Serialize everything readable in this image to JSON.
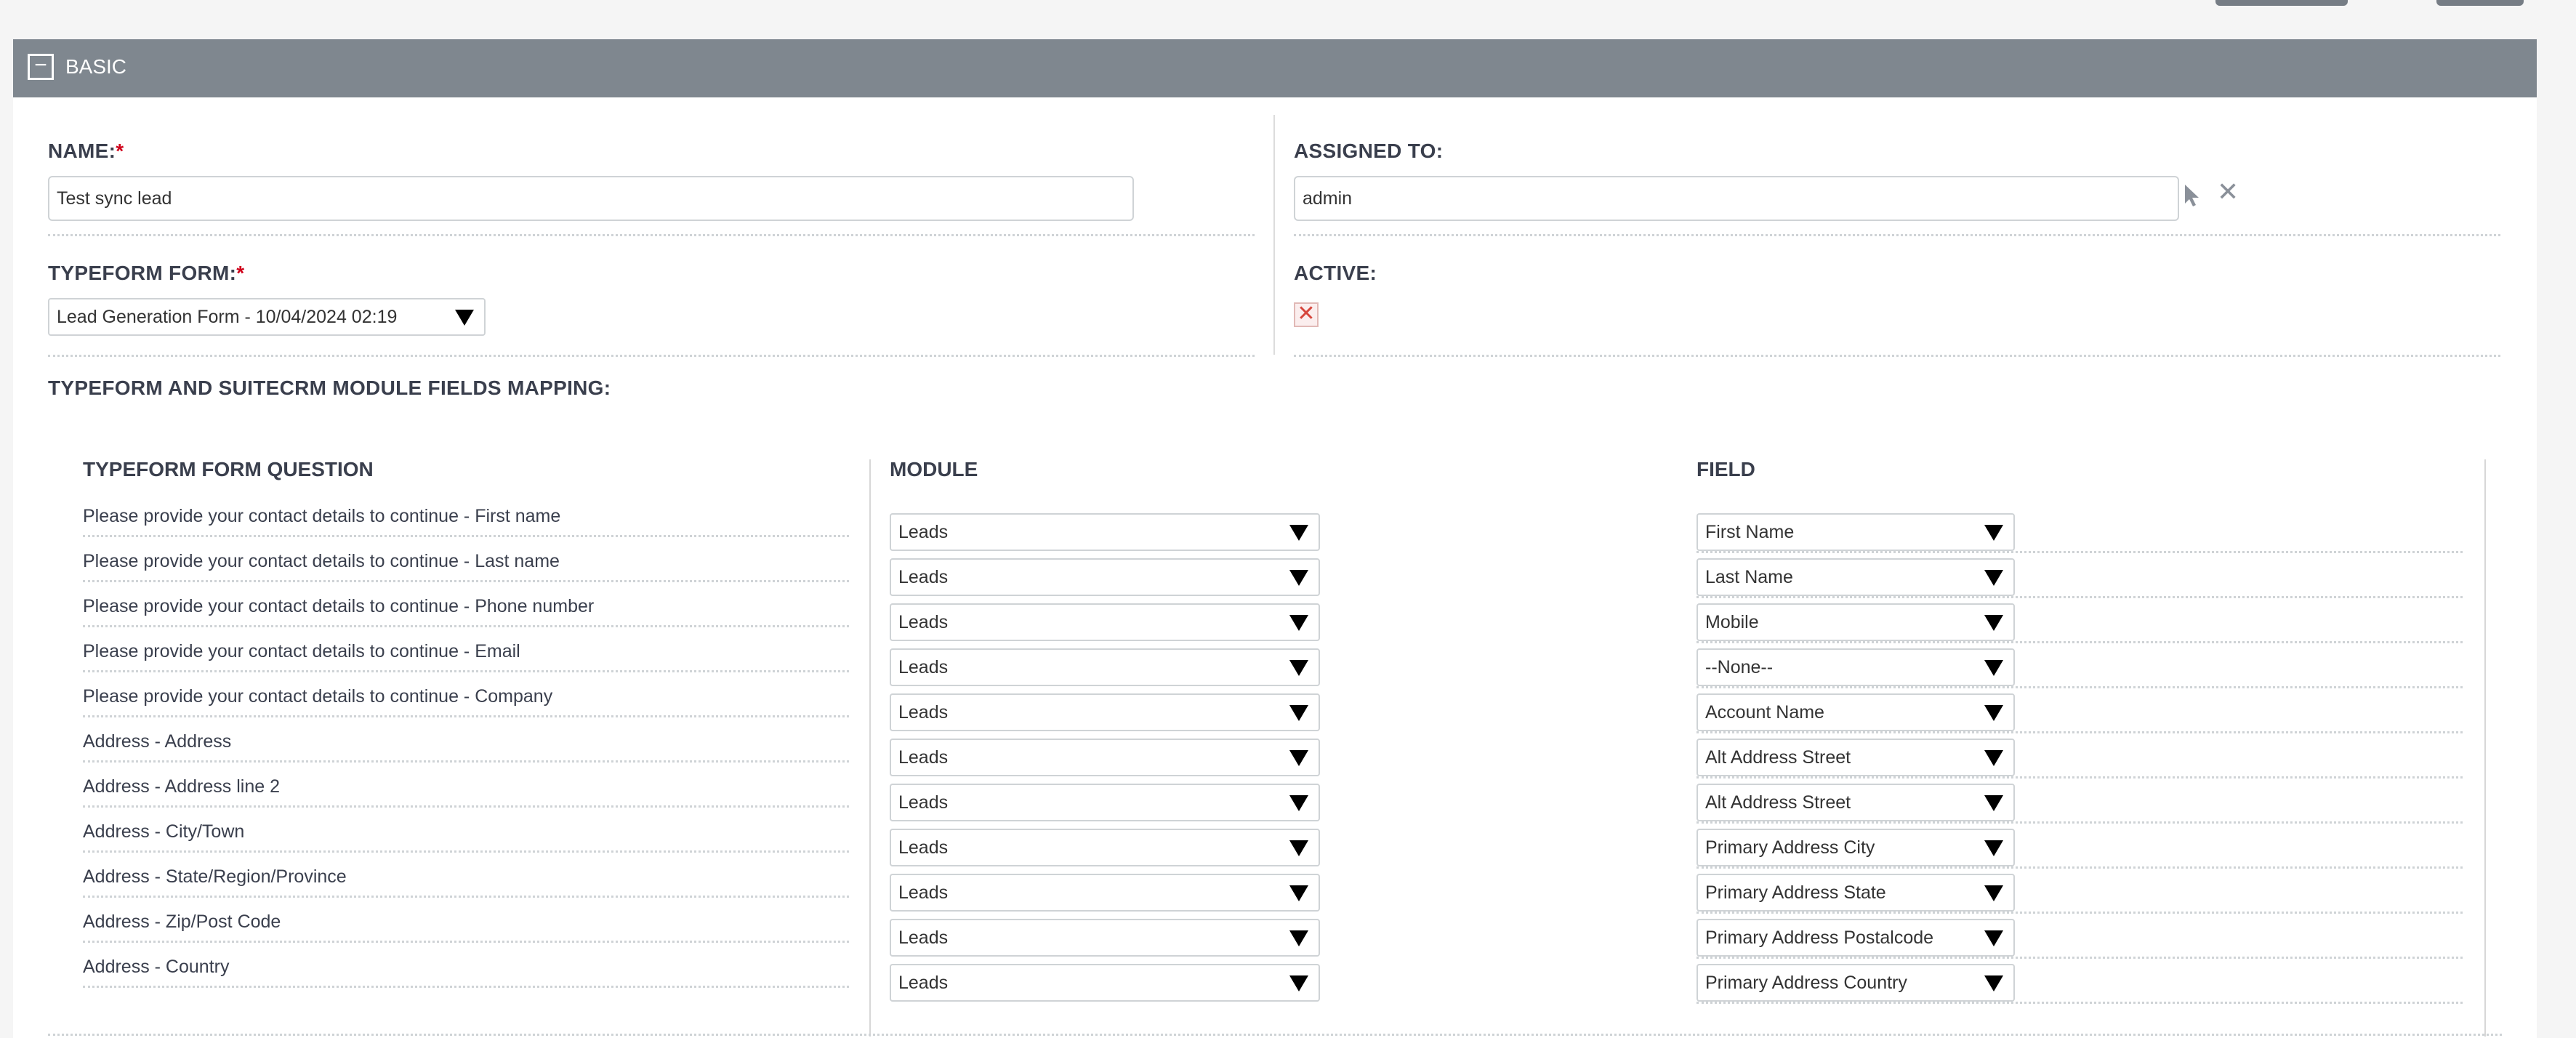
{
  "panel": {
    "title": "BASIC",
    "collapse_symbol": "−"
  },
  "fields": {
    "name": {
      "label": "NAME:",
      "required_mark": "*",
      "value": "Test sync lead"
    },
    "assigned_to": {
      "label": "ASSIGNED TO:",
      "value": "admin"
    },
    "typeform_form": {
      "label": "TYPEFORM FORM:",
      "required_mark": "*",
      "value": "Lead Generation Form - 10/04/2024 02:19"
    },
    "active": {
      "label": "ACTIVE:",
      "value": "✕"
    }
  },
  "mapping": {
    "title": "TYPEFORM AND SUITECRM MODULE FIELDS MAPPING:",
    "columns": {
      "question": "TYPEFORM FORM QUESTION",
      "module": "MODULE",
      "field": "FIELD"
    },
    "rows": [
      {
        "question": "Please provide your contact details to continue - First name",
        "module": "Leads",
        "field": "First Name"
      },
      {
        "question": "Please provide your contact details to continue - Last name",
        "module": "Leads",
        "field": "Last Name"
      },
      {
        "question": "Please provide your contact details to continue - Phone number",
        "module": "Leads",
        "field": "Mobile"
      },
      {
        "question": "Please provide your contact details to continue - Email",
        "module": "Leads",
        "field": "--None--"
      },
      {
        "question": "Please provide your contact details to continue - Company",
        "module": "Leads",
        "field": "Account Name"
      },
      {
        "question": "Address - Address",
        "module": "Leads",
        "field": "Alt Address Street"
      },
      {
        "question": "Address - Address line 2",
        "module": "Leads",
        "field": "Alt Address Street"
      },
      {
        "question": "Address - City/Town",
        "module": "Leads",
        "field": "Primary Address City"
      },
      {
        "question": "Address - State/Region/Province",
        "module": "Leads",
        "field": "Primary Address State"
      },
      {
        "question": "Address - Zip/Post Code",
        "module": "Leads",
        "field": "Primary Address Postalcode"
      },
      {
        "question": "Address - Country",
        "module": "Leads",
        "field": "Primary Address Country"
      }
    ]
  },
  "icons": {
    "select_user": "cursor-arrow-icon",
    "clear": "close-icon",
    "active_state": "checkbox-cross-icon"
  },
  "colors": {
    "header_bg": "#7f878f",
    "required": "#d0021b",
    "page_bg": "#f5f5f5"
  }
}
